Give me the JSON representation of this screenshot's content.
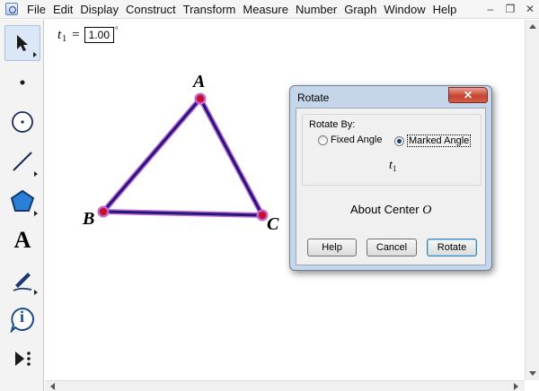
{
  "menu": {
    "items": [
      "File",
      "Edit",
      "Display",
      "Construct",
      "Transform",
      "Measure",
      "Number",
      "Graph",
      "Window",
      "Help"
    ],
    "window_controls": {
      "minimize": "–",
      "restore": "❐",
      "close": "✕"
    }
  },
  "toolbox": {
    "tools": [
      {
        "name": "selection-arrow-tool",
        "icon": "arrow-icon",
        "selected": true
      },
      {
        "name": "point-tool",
        "icon": "point-icon"
      },
      {
        "name": "compass-tool",
        "icon": "circle-icon"
      },
      {
        "name": "straightedge-tool",
        "icon": "segment-icon"
      },
      {
        "name": "polygon-tool",
        "icon": "polygon-icon"
      },
      {
        "name": "text-tool",
        "icon": "text-icon",
        "glyph": "A"
      },
      {
        "name": "marker-tool",
        "icon": "marker-pen-icon"
      },
      {
        "name": "information-tool",
        "icon": "info-icon",
        "glyph": "i"
      },
      {
        "name": "custom-tool",
        "icon": "custom-tools-icon"
      }
    ]
  },
  "canvas": {
    "parameter": {
      "name": "t",
      "subscript": "1",
      "equals": "=",
      "value": "1.00",
      "unit": "°"
    },
    "points": {
      "A": "A",
      "B": "B",
      "C": "C"
    },
    "colors": {
      "segment": "#1f1a78",
      "highlight": "#c267d6",
      "point": "#c8102e"
    }
  },
  "dialog": {
    "title": "Rotate",
    "close_label": "✕",
    "group_label": "Rotate By:",
    "option_fixed": "Fixed Angle",
    "option_marked": "Marked Angle",
    "selected_option": "Marked Angle",
    "angle_name": "t",
    "angle_subscript": "1",
    "about_center_label": "About Center",
    "center_name": "O",
    "buttons": {
      "help": "Help",
      "cancel": "Cancel",
      "rotate": "Rotate"
    }
  }
}
